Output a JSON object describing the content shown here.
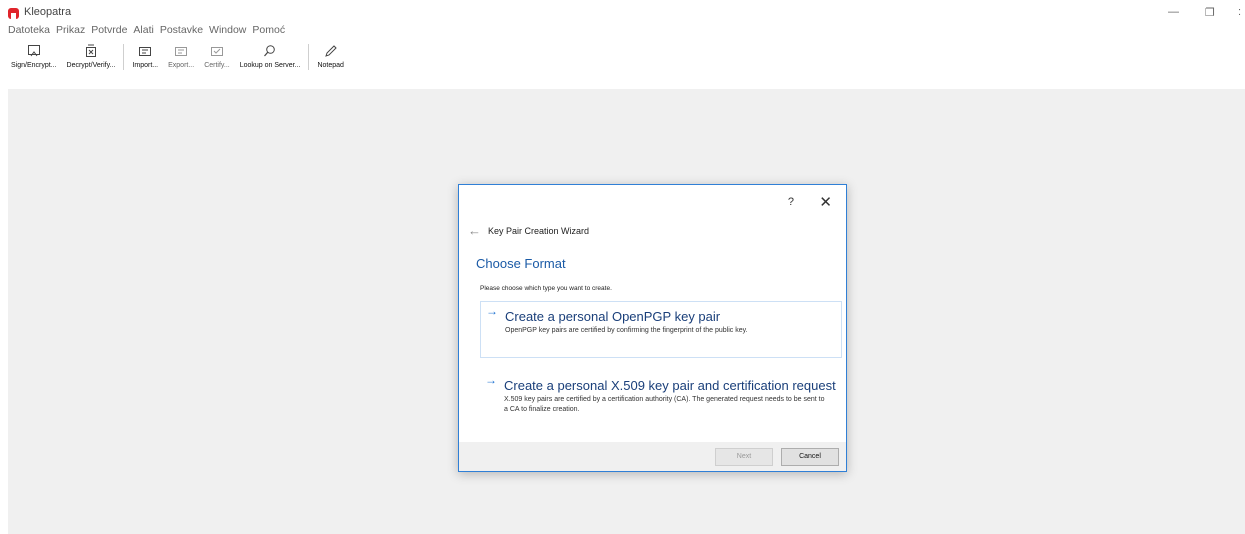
{
  "window": {
    "title": "Kleopatra",
    "minimize_glyph": "—",
    "maximize_glyph": "❐",
    "close_glyph": ":"
  },
  "menu": [
    "Datoteka",
    "Prikaz",
    "Potvrde",
    "Alati",
    "Postavke",
    "Window",
    "Pomoć"
  ],
  "toolbar": {
    "items": [
      {
        "label": "Sign/Encrypt...",
        "icon": "sign-encrypt-icon",
        "enabled": true
      },
      {
        "label": "Decrypt/Verify...",
        "icon": "decrypt-verify-icon",
        "enabled": true
      },
      {
        "label": "Import...",
        "icon": "import-icon",
        "enabled": true
      },
      {
        "label": "Export...",
        "icon": "export-icon",
        "enabled": false
      },
      {
        "label": "Certify...",
        "icon": "certify-icon",
        "enabled": false
      },
      {
        "label": "Lookup on Server...",
        "icon": "search-icon",
        "enabled": true
      },
      {
        "label": "Notepad",
        "icon": "pencil-icon",
        "enabled": true
      }
    ]
  },
  "dialog": {
    "help": "?",
    "close": "✕",
    "back_arrow": "←",
    "heading": "Key Pair Creation Wizard",
    "section_title": "Choose Format",
    "description": "Please choose which type you want to create.",
    "options": [
      {
        "arrow": "→",
        "title": "Create a personal OpenPGP key pair",
        "text": "OpenPGP key pairs are certified by confirming the fingerprint of the public key."
      },
      {
        "arrow": "→",
        "title": "Create a personal X.509 key pair and certification request",
        "text": "X.509 key pairs are certified by a certification authority (CA). The generated request needs to be sent to a CA to finalize creation."
      }
    ],
    "buttons": {
      "next": "Next",
      "cancel": "Cancel"
    }
  },
  "colors": {
    "accent": "#1a5aa6",
    "dialog_border": "#2f7fd6",
    "workspace_bg": "#f0f0f0",
    "logo": "#e0242b"
  }
}
